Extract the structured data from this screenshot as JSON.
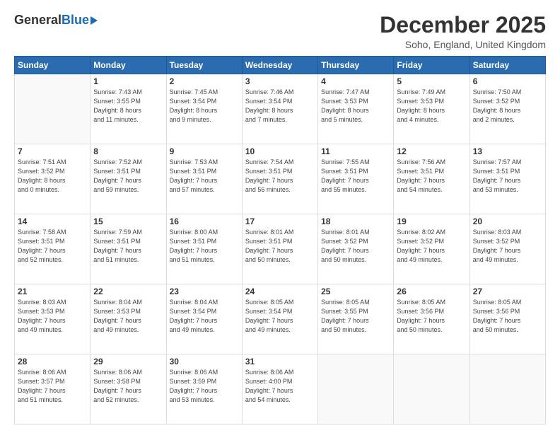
{
  "header": {
    "logo_general": "General",
    "logo_blue": "Blue",
    "title": "December 2025",
    "subtitle": "Soho, England, United Kingdom"
  },
  "days_of_week": [
    "Sunday",
    "Monday",
    "Tuesday",
    "Wednesday",
    "Thursday",
    "Friday",
    "Saturday"
  ],
  "weeks": [
    [
      {
        "day": "",
        "info": ""
      },
      {
        "day": "1",
        "info": "Sunrise: 7:43 AM\nSunset: 3:55 PM\nDaylight: 8 hours\nand 11 minutes."
      },
      {
        "day": "2",
        "info": "Sunrise: 7:45 AM\nSunset: 3:54 PM\nDaylight: 8 hours\nand 9 minutes."
      },
      {
        "day": "3",
        "info": "Sunrise: 7:46 AM\nSunset: 3:54 PM\nDaylight: 8 hours\nand 7 minutes."
      },
      {
        "day": "4",
        "info": "Sunrise: 7:47 AM\nSunset: 3:53 PM\nDaylight: 8 hours\nand 5 minutes."
      },
      {
        "day": "5",
        "info": "Sunrise: 7:49 AM\nSunset: 3:53 PM\nDaylight: 8 hours\nand 4 minutes."
      },
      {
        "day": "6",
        "info": "Sunrise: 7:50 AM\nSunset: 3:52 PM\nDaylight: 8 hours\nand 2 minutes."
      }
    ],
    [
      {
        "day": "7",
        "info": "Sunrise: 7:51 AM\nSunset: 3:52 PM\nDaylight: 8 hours\nand 0 minutes."
      },
      {
        "day": "8",
        "info": "Sunrise: 7:52 AM\nSunset: 3:51 PM\nDaylight: 7 hours\nand 59 minutes."
      },
      {
        "day": "9",
        "info": "Sunrise: 7:53 AM\nSunset: 3:51 PM\nDaylight: 7 hours\nand 57 minutes."
      },
      {
        "day": "10",
        "info": "Sunrise: 7:54 AM\nSunset: 3:51 PM\nDaylight: 7 hours\nand 56 minutes."
      },
      {
        "day": "11",
        "info": "Sunrise: 7:55 AM\nSunset: 3:51 PM\nDaylight: 7 hours\nand 55 minutes."
      },
      {
        "day": "12",
        "info": "Sunrise: 7:56 AM\nSunset: 3:51 PM\nDaylight: 7 hours\nand 54 minutes."
      },
      {
        "day": "13",
        "info": "Sunrise: 7:57 AM\nSunset: 3:51 PM\nDaylight: 7 hours\nand 53 minutes."
      }
    ],
    [
      {
        "day": "14",
        "info": "Sunrise: 7:58 AM\nSunset: 3:51 PM\nDaylight: 7 hours\nand 52 minutes."
      },
      {
        "day": "15",
        "info": "Sunrise: 7:59 AM\nSunset: 3:51 PM\nDaylight: 7 hours\nand 51 minutes."
      },
      {
        "day": "16",
        "info": "Sunrise: 8:00 AM\nSunset: 3:51 PM\nDaylight: 7 hours\nand 51 minutes."
      },
      {
        "day": "17",
        "info": "Sunrise: 8:01 AM\nSunset: 3:51 PM\nDaylight: 7 hours\nand 50 minutes."
      },
      {
        "day": "18",
        "info": "Sunrise: 8:01 AM\nSunset: 3:52 PM\nDaylight: 7 hours\nand 50 minutes."
      },
      {
        "day": "19",
        "info": "Sunrise: 8:02 AM\nSunset: 3:52 PM\nDaylight: 7 hours\nand 49 minutes."
      },
      {
        "day": "20",
        "info": "Sunrise: 8:03 AM\nSunset: 3:52 PM\nDaylight: 7 hours\nand 49 minutes."
      }
    ],
    [
      {
        "day": "21",
        "info": "Sunrise: 8:03 AM\nSunset: 3:53 PM\nDaylight: 7 hours\nand 49 minutes."
      },
      {
        "day": "22",
        "info": "Sunrise: 8:04 AM\nSunset: 3:53 PM\nDaylight: 7 hours\nand 49 minutes."
      },
      {
        "day": "23",
        "info": "Sunrise: 8:04 AM\nSunset: 3:54 PM\nDaylight: 7 hours\nand 49 minutes."
      },
      {
        "day": "24",
        "info": "Sunrise: 8:05 AM\nSunset: 3:54 PM\nDaylight: 7 hours\nand 49 minutes."
      },
      {
        "day": "25",
        "info": "Sunrise: 8:05 AM\nSunset: 3:55 PM\nDaylight: 7 hours\nand 50 minutes."
      },
      {
        "day": "26",
        "info": "Sunrise: 8:05 AM\nSunset: 3:56 PM\nDaylight: 7 hours\nand 50 minutes."
      },
      {
        "day": "27",
        "info": "Sunrise: 8:05 AM\nSunset: 3:56 PM\nDaylight: 7 hours\nand 50 minutes."
      }
    ],
    [
      {
        "day": "28",
        "info": "Sunrise: 8:06 AM\nSunset: 3:57 PM\nDaylight: 7 hours\nand 51 minutes."
      },
      {
        "day": "29",
        "info": "Sunrise: 8:06 AM\nSunset: 3:58 PM\nDaylight: 7 hours\nand 52 minutes."
      },
      {
        "day": "30",
        "info": "Sunrise: 8:06 AM\nSunset: 3:59 PM\nDaylight: 7 hours\nand 53 minutes."
      },
      {
        "day": "31",
        "info": "Sunrise: 8:06 AM\nSunset: 4:00 PM\nDaylight: 7 hours\nand 54 minutes."
      },
      {
        "day": "",
        "info": ""
      },
      {
        "day": "",
        "info": ""
      },
      {
        "day": "",
        "info": ""
      }
    ]
  ]
}
